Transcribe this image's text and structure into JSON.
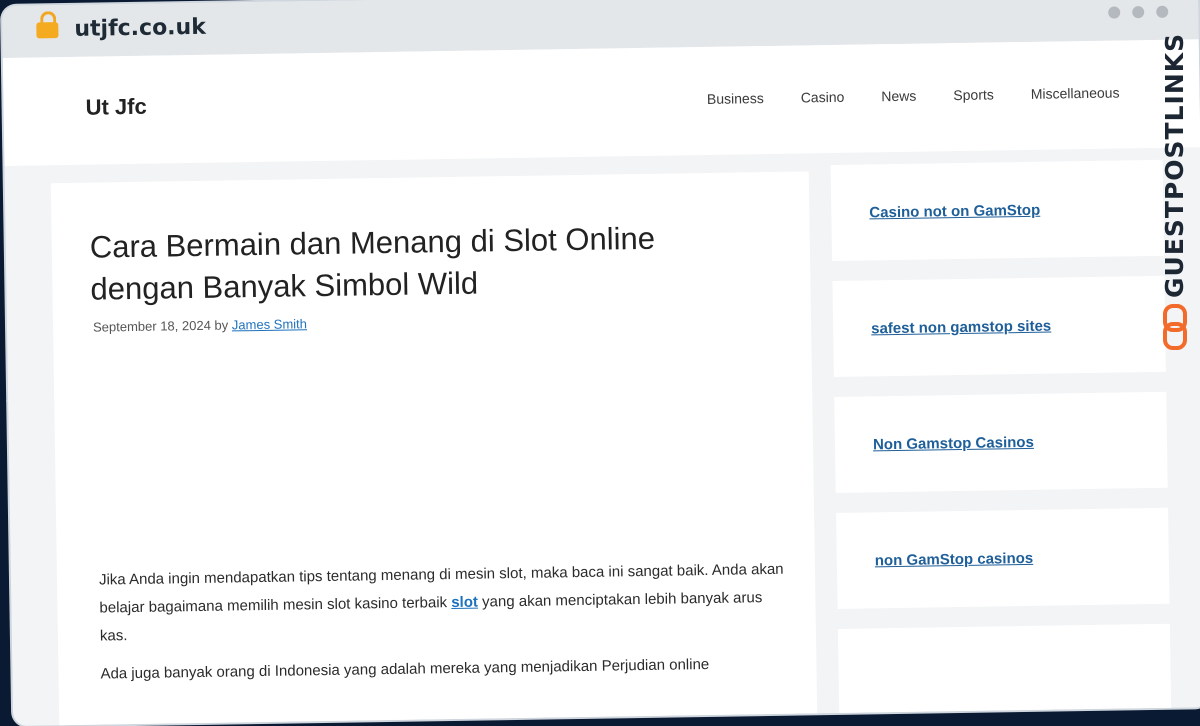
{
  "browser": {
    "url": "utjfc.co.uk"
  },
  "site": {
    "title": "Ut Jfc",
    "nav": [
      "Business",
      "Casino",
      "News",
      "Sports",
      "Miscellaneous"
    ]
  },
  "post": {
    "title": "Cara Bermain dan Menang di Slot Online dengan Banyak Simbol Wild",
    "date": "September 18, 2024",
    "by": "by",
    "author": "James Smith",
    "p1_before": "Jika Anda ingin mendapatkan tips tentang menang di mesin slot, maka baca ini sangat baik. Anda akan belajar bagaimana memilih mesin slot kasino terbaik ",
    "p1_link": "slot",
    "p1_after": " yang akan menciptakan lebih banyak arus kas.",
    "p2_partial": "Ada juga banyak orang di Indonesia yang adalah mereka yang menjadikan Perjudian online"
  },
  "sidebar": {
    "links": [
      "Casino not on GamStop",
      "safest non gamstop sites",
      "Non Gamstop Casinos",
      "non GamStop casinos"
    ]
  },
  "badge": {
    "text": "GUESTPOSTLINKS"
  },
  "colors": {
    "link": "#1e72bd",
    "sidebar_link": "#1f5f99",
    "badge_accent": "#f26b2b",
    "lock": "#f5ab1f",
    "background": "#0b1a33"
  }
}
